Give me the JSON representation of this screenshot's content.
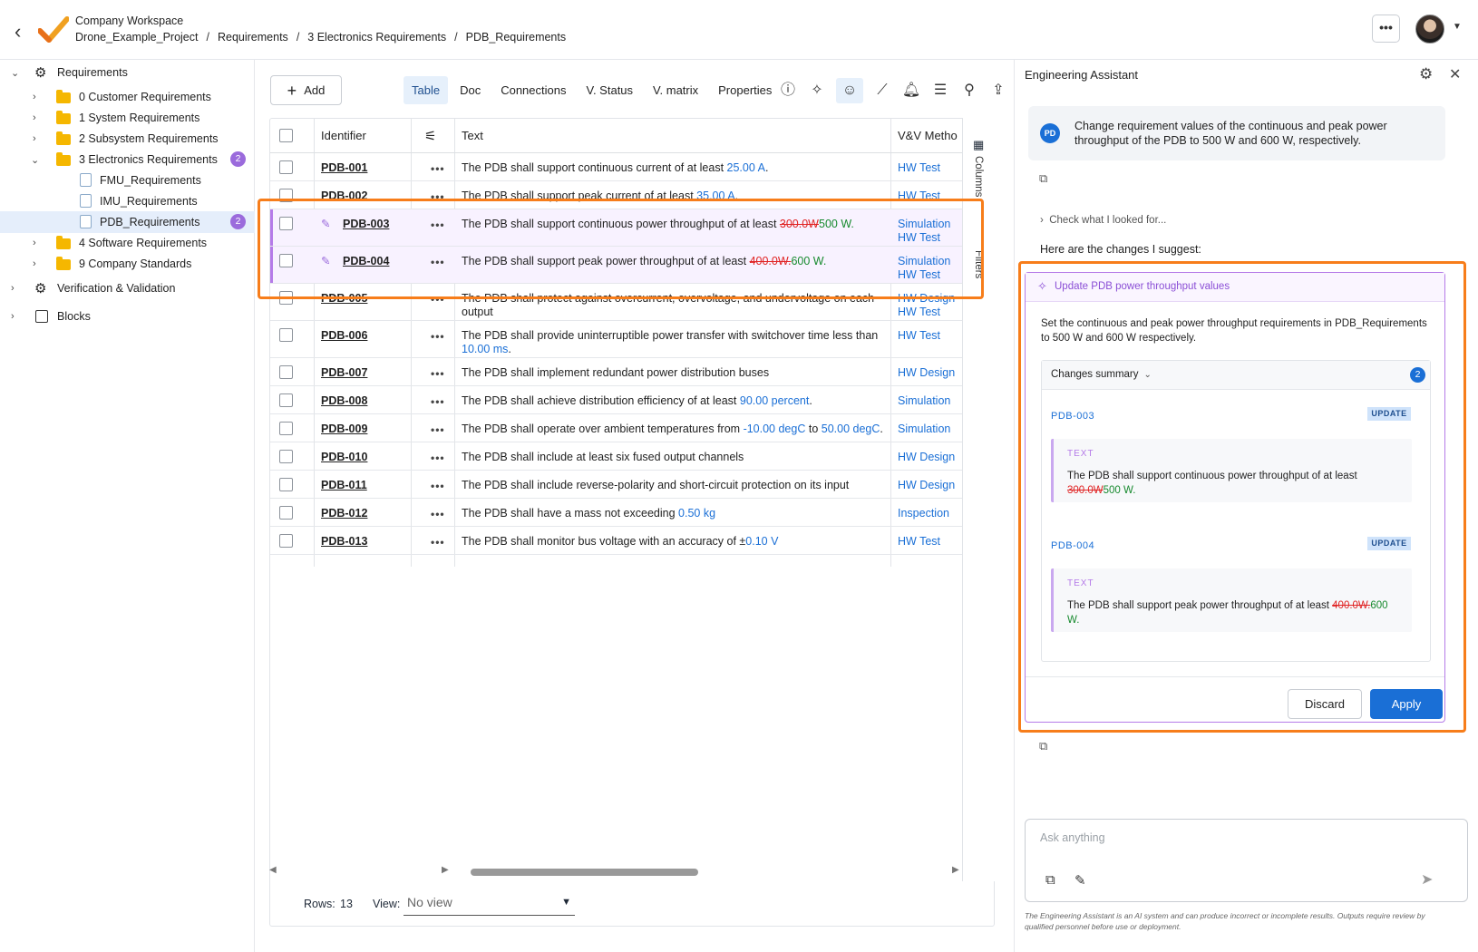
{
  "header": {
    "workspace": "Company Workspace",
    "breadcrumb": [
      "Drone_Example_Project",
      "Requirements",
      "3 Electronics Requirements",
      "PDB_Requirements"
    ],
    "more_label": "•••"
  },
  "tree": {
    "root": "Requirements",
    "items": [
      {
        "label": "0 Customer Requirements"
      },
      {
        "label": "1 System Requirements"
      },
      {
        "label": "2 Subsystem Requirements"
      },
      {
        "label": "3 Electronics Requirements",
        "badge": "2"
      },
      {
        "label": "FMU_Requirements"
      },
      {
        "label": "IMU_Requirements"
      },
      {
        "label": "PDB_Requirements",
        "badge": "2"
      },
      {
        "label": "4 Software Requirements"
      },
      {
        "label": "9 Company Standards"
      }
    ],
    "verification": "Verification & Validation",
    "blocks": "Blocks"
  },
  "toolbar": {
    "add_label": "Add",
    "tabs": [
      "Table",
      "Doc",
      "Connections",
      "V. Status",
      "V. matrix",
      "Properties"
    ],
    "active_tab": "Table"
  },
  "table": {
    "headers": {
      "identifier": "Identifier",
      "text": "Text",
      "vv": "V&V Metho"
    },
    "side_labels": {
      "columns": "Columns",
      "filters": "Filters"
    },
    "rows": [
      {
        "id": "PDB-001",
        "text": "The PDB shall support continuous current of at least ",
        "num": "25.00  A",
        "tail": ".",
        "vv": [
          "HW Test"
        ]
      },
      {
        "id": "PDB-002",
        "text": "The PDB shall support peak current of at least ",
        "num": "35.00  A",
        "tail": ".",
        "vv": [
          "HW Test"
        ]
      },
      {
        "id": "PDB-003",
        "text": "The PDB shall support continuous power throughput of at least ",
        "del": "300.0W",
        "ins": "500 W.",
        "vv": [
          "Simulation",
          "HW Test"
        ]
      },
      {
        "id": "PDB-004",
        "text": "The PDB shall support peak power throughput of at least ",
        "del": "400.0W.",
        "ins": "600 W.",
        "vv": [
          "Simulation",
          "HW Test"
        ]
      },
      {
        "id": "PDB-005",
        "text": "The PDB shall protect against overcurrent, overvoltage, and undervoltage on each output",
        "vv": [
          "HW Design",
          "HW Test"
        ]
      },
      {
        "id": "PDB-006",
        "text": "The PDB shall provide uninterruptible power transfer with switchover time less than ",
        "num": "10.00  ms",
        "tail": ".",
        "vv": [
          "HW Test"
        ]
      },
      {
        "id": "PDB-007",
        "text": "The PDB shall implement redundant power distribution buses",
        "vv": [
          "HW Design"
        ]
      },
      {
        "id": "PDB-008",
        "text": "The PDB shall achieve distribution efficiency of at least ",
        "num": "90.00  percent",
        "tail": ".",
        "vv": [
          "Simulation"
        ]
      },
      {
        "id": "PDB-009",
        "text": "The PDB shall operate over ambient temperatures from ",
        "num": "-10.00  degC",
        "mid": " to ",
        "num2": "50.00  degC",
        "tail": ".",
        "vv": [
          "Simulation"
        ]
      },
      {
        "id": "PDB-010",
        "text": "The PDB shall include at least six fused output channels",
        "vv": [
          "HW Design"
        ]
      },
      {
        "id": "PDB-011",
        "text": "The PDB shall include reverse-polarity and short-circuit protection on its input",
        "vv": [
          "HW Design"
        ]
      },
      {
        "id": "PDB-012",
        "text": "The PDB shall have a mass not exceeding ",
        "num": "0.50  kg",
        "vv": [
          "Inspection"
        ]
      },
      {
        "id": "PDB-013",
        "text": "The PDB shall monitor bus voltage with an accuracy of ±",
        "num": "0.10  V",
        "vv": [
          "HW Test"
        ]
      }
    ],
    "footer": {
      "rows_label": "Rows:",
      "rows_count": "13",
      "view_label": "View:",
      "view_value": "No view"
    }
  },
  "assistant": {
    "title": "Engineering Assistant",
    "user_initials": "PD",
    "user_message": "Change requirement values of the continuous and peak power throughput of the PDB to 500 W and 600 W, respectively.",
    "check_label": "Check what I looked for...",
    "intro": "Here are the changes I suggest:",
    "card": {
      "title": "Update PDB power throughput values",
      "description": "Set the continuous and peak power throughput requirements in PDB_Requirements to 500 W and 600 W respectively.",
      "summary_label": "Changes summary",
      "summary_count": "2",
      "changes": [
        {
          "id": "PDB-003",
          "tag": "UPDATE",
          "field": "TEXT",
          "text": "The PDB shall support continuous power throughput of at least ",
          "del": "300.0W",
          "ins": "500 W."
        },
        {
          "id": "PDB-004",
          "tag": "UPDATE",
          "field": "TEXT",
          "text": "The PDB shall support peak power throughput of at least ",
          "del": "400.0W.",
          "ins": "600 W."
        }
      ],
      "discard_label": "Discard",
      "apply_label": "Apply"
    },
    "input_placeholder": "Ask anything",
    "disclaimer": "The Engineering Assistant is an AI system and can produce incorrect or incomplete results. Outputs require review by qualified personnel before use or deployment."
  },
  "colors": {
    "accent": "#1a6fd6",
    "highlight": "#f77d1a",
    "purple": "#9b6bdc",
    "deleted": "#e02424",
    "inserted": "#178a2e"
  }
}
